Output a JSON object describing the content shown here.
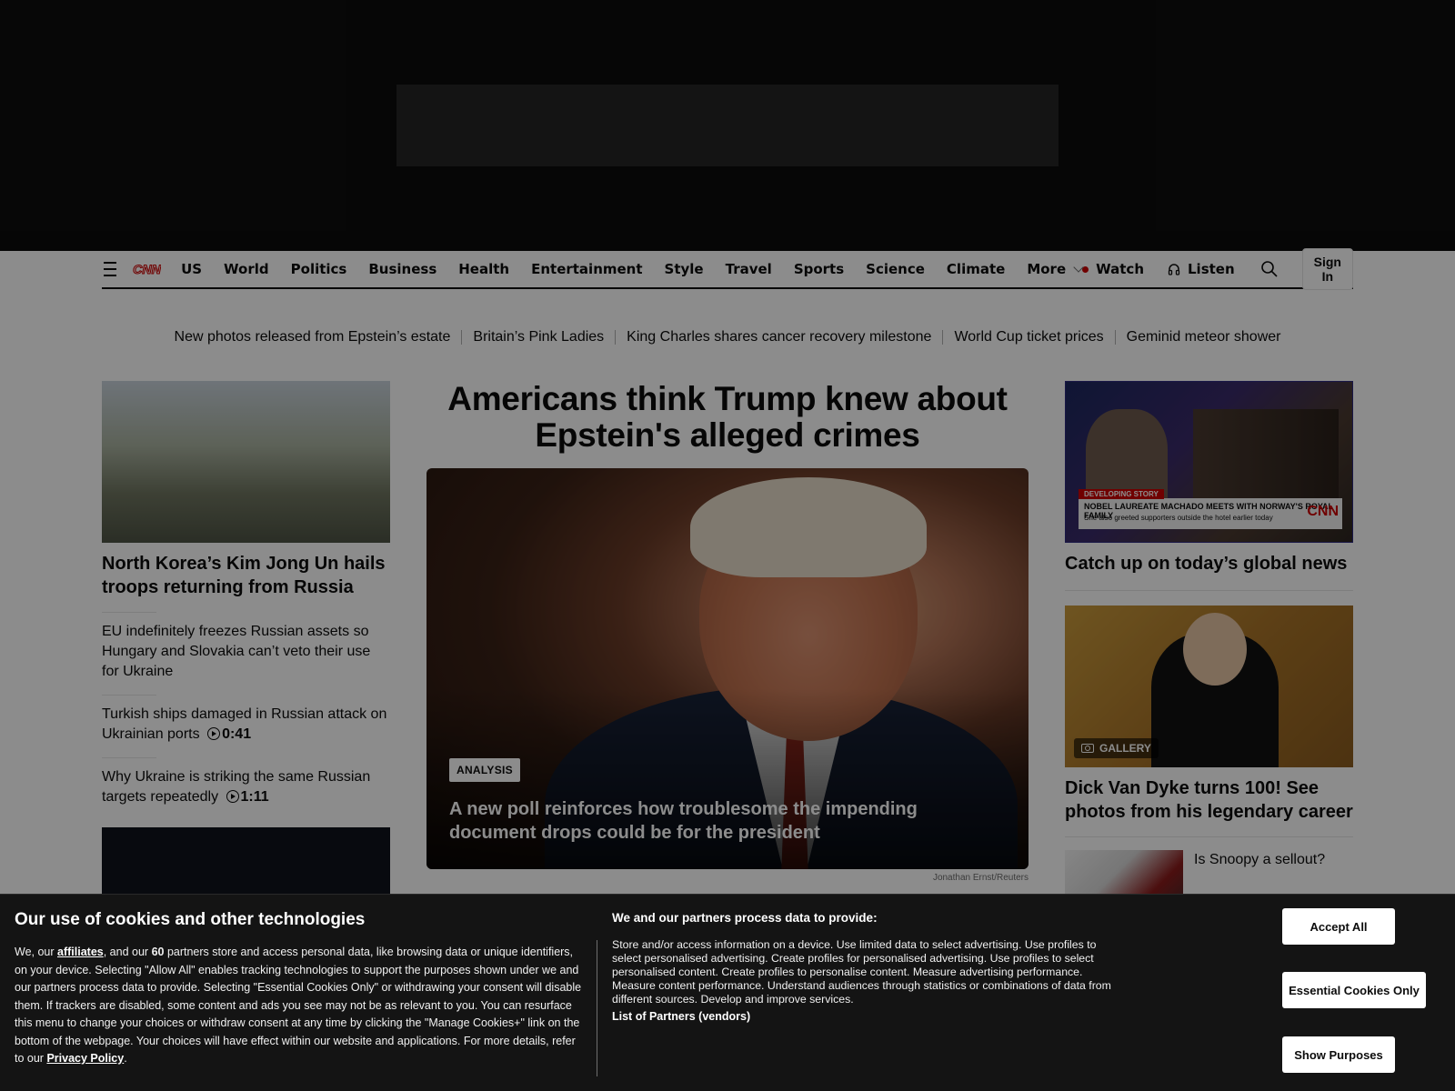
{
  "nav": {
    "links": [
      "US",
      "World",
      "Politics",
      "Business",
      "Health",
      "Entertainment",
      "Style",
      "Travel",
      "Sports",
      "Science",
      "Climate"
    ],
    "more_label": "More",
    "watch_label": "Watch",
    "listen_label": "Listen",
    "signin_label": "Sign In",
    "logo_text": "CNN",
    "brand_color": "#cc0000"
  },
  "trending": [
    "New photos released from Epstein’s estate",
    "Britain’s Pink Ladies",
    "King Charles shares cancer recovery milestone",
    "World Cup ticket prices",
    "Geminid meteor shower"
  ],
  "left": {
    "lead_title": "North Korea’s Kim Jong Un hails troops returning from Russia",
    "stories": [
      {
        "text": "EU indefinitely freezes Russian assets so Hungary and Slovakia can’t veto their use for Ukraine",
        "duration": ""
      },
      {
        "text": "Turkish ships damaged in Russian attack on Ukrainian ports",
        "duration": "0:41"
      },
      {
        "text": "Why Ukraine is striking the same Russian targets repeatedly",
        "duration": "1:11"
      }
    ]
  },
  "center": {
    "headline": "Americans think Trump knew about Epstein's alleged crimes",
    "badge": "ANALYSIS",
    "subhead": "A new poll reinforces how troublesome the impending document drops could be for the president",
    "credit": "Jonathan Ernst/Reuters"
  },
  "right": {
    "video_title": "Catch up on today’s global news",
    "video_overlay": {
      "tag": "DEVELOPING STORY",
      "line1": "NOBEL LAUREATE MACHADO MEETS WITH NORWAY'S ROYAL FAMILY",
      "line2": "She also greeted supporters outside the hotel earlier today",
      "logo": "CNN"
    },
    "gallery_label": "GALLERY",
    "gallery_title": "Dick Van Dyke turns 100! See photos from his legendary career",
    "small_story": "Is Snoopy a sellout?"
  },
  "cookie": {
    "title": "Our use of cookies and other technologies",
    "body_prefix": "We, our ",
    "affiliates_link": "affiliates",
    "body_mid": ", and our ",
    "partner_count": "60",
    "body_main": " partners store and access personal data, like browsing data or unique identifiers, on your device. Selecting \"Allow All\" enables tracking technologies to support the purposes shown under we and our partners process data to provide. Selecting \"Essential Cookies Only\" or withdrawing your consent will disable them. If trackers are disabled, some content and ads you see may not be as relevant to you. You can resurface this menu to change your choices or withdraw consent at any time by clicking the \"Manage Cookies+\" link on the bottom of the webpage. Your choices will have effect within our website and applications. For more details, refer to our ",
    "privacy_link": "Privacy Policy",
    "body_end": ".",
    "purposes_title": "We and our partners process data to provide:",
    "purposes_body": "Store and/or access information on a device. Use limited data to select advertising. Use profiles to select personalised advertising. Create profiles for personalised advertising. Use profiles to select personalised content. Create profiles to personalise content. Measure advertising performance. Measure content performance. Understand audiences through statistics or combinations of data from different sources. Develop and improve services.",
    "partners_link": "List of Partners (vendors)",
    "accept_label": "Accept All",
    "essential_label": "Essential Cookies Only",
    "purposes_label": "Show Purposes"
  }
}
